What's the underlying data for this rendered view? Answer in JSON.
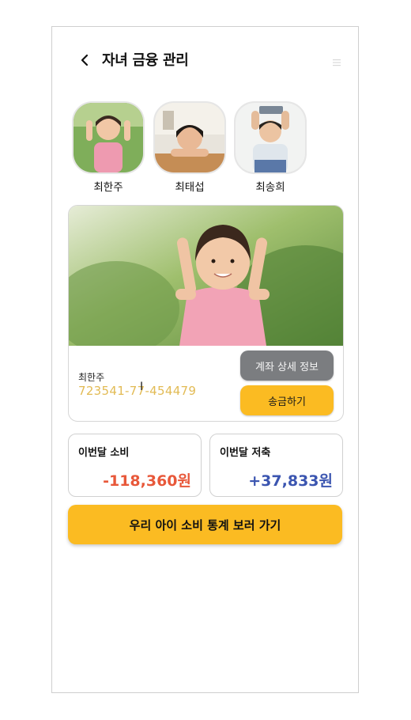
{
  "header": {
    "title": "자녀 금융 관리"
  },
  "children": [
    {
      "name": "최한주"
    },
    {
      "name": "최태섭"
    },
    {
      "name": "최송희"
    }
  ],
  "account_card": {
    "owner": "최한주",
    "account_number": "723541-77-454479",
    "detail_button": "계좌 상세 정보",
    "send_button": "송금하기"
  },
  "stats": {
    "spend_label": "이번달 소비",
    "spend_value": "-118,360원",
    "save_label": "이번달 저축",
    "save_value": "+37,833원"
  },
  "cta": {
    "label": "우리 아이 소비 통계 보러 가기"
  },
  "colors": {
    "accent": "#fbbb22",
    "gray_button": "#7b7d80",
    "spend": "#e8583a",
    "save": "#3b55b0",
    "account_text": "#e2bb55"
  },
  "icons": {
    "back": "chevron-left-icon",
    "menu": "menu-icon"
  }
}
